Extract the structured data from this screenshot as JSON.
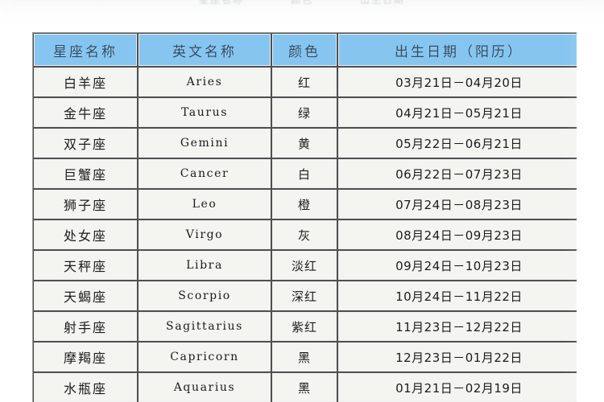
{
  "page": {
    "ghost_top_text": [
      "星座名称",
      "颜色",
      "出生日期"
    ]
  },
  "table": {
    "columns": [
      {
        "key": "name",
        "label": "星座名称"
      },
      {
        "key": "eng",
        "label": "英文名称"
      },
      {
        "key": "color",
        "label": "颜色"
      },
      {
        "key": "date",
        "label": "出生日期（阳历）"
      }
    ],
    "rows": [
      {
        "name": "白羊座",
        "eng": "Aries",
        "color": "红",
        "date": "03月21日－04月20日"
      },
      {
        "name": "金牛座",
        "eng": "Taurus",
        "color": "绿",
        "date": "04月21日－05月21日"
      },
      {
        "name": "双子座",
        "eng": "Gemini",
        "color": "黄",
        "date": "05月22日－06月21日"
      },
      {
        "name": "巨蟹座",
        "eng": "Cancer",
        "color": "白",
        "date": "06月22日－07月23日"
      },
      {
        "name": "狮子座",
        "eng": "Leo",
        "color": "橙",
        "date": "07月24日－08月23日"
      },
      {
        "name": "处女座",
        "eng": "Virgo",
        "color": "灰",
        "date": "08月24日－09月23日"
      },
      {
        "name": "天秤座",
        "eng": "Libra",
        "color": "淡红",
        "date": "09月24日－10月23日"
      },
      {
        "name": "天蝎座",
        "eng": "Scorpio",
        "color": "深红",
        "date": "10月24日－11月22日"
      },
      {
        "name": "射手座",
        "eng": "Sagittarius",
        "color": "紫红",
        "date": "11月23日－12月22日"
      },
      {
        "name": "摩羯座",
        "eng": "Capricorn",
        "color": "黑",
        "date": "12月23日－01月22日"
      },
      {
        "name": "水瓶座",
        "eng": "Aquarius",
        "color": "黑",
        "date": "01月21日－02月19日"
      }
    ]
  },
  "colors": {
    "header_blue": "#86c5f0",
    "header_text": "#2d4a63",
    "cell_bg": "#f4f4f1",
    "cell_text": "#1b1b1b",
    "border_dark": "#4f4f4f",
    "page_bg": "#ffffff"
  }
}
